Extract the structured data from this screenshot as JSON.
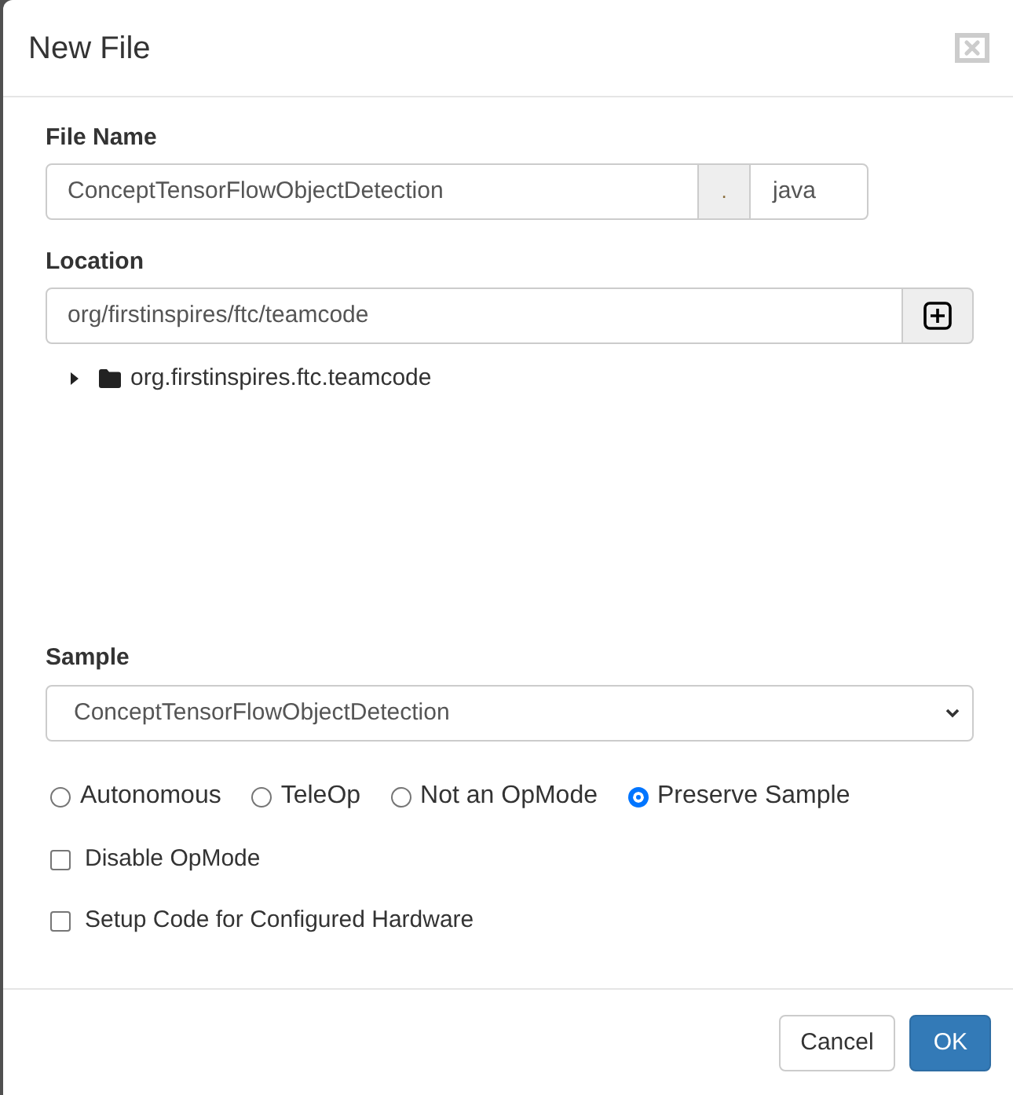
{
  "dialog": {
    "title": "New File"
  },
  "file_name": {
    "label": "File Name",
    "value": "ConceptTensorFlowObjectDetection",
    "separator": ".",
    "extension": "java"
  },
  "location": {
    "label": "Location",
    "value": "org/firstinspires/ftc/teamcode",
    "tree": [
      {
        "label": "org.firstinspires.ftc.teamcode",
        "expanded": false
      }
    ]
  },
  "sample": {
    "label": "Sample",
    "value": "ConceptTensorFlowObjectDetection"
  },
  "opmode_types": [
    {
      "label": "Autonomous",
      "selected": false
    },
    {
      "label": "TeleOp",
      "selected": false
    },
    {
      "label": "Not an OpMode",
      "selected": false
    },
    {
      "label": "Preserve Sample",
      "selected": true
    }
  ],
  "options": [
    {
      "label": "Disable OpMode",
      "checked": false
    },
    {
      "label": "Setup Code for Configured Hardware",
      "checked": false
    }
  ],
  "buttons": [
    {
      "label": "Cancel",
      "kind": "default"
    },
    {
      "label": "OK",
      "kind": "primary"
    }
  ]
}
